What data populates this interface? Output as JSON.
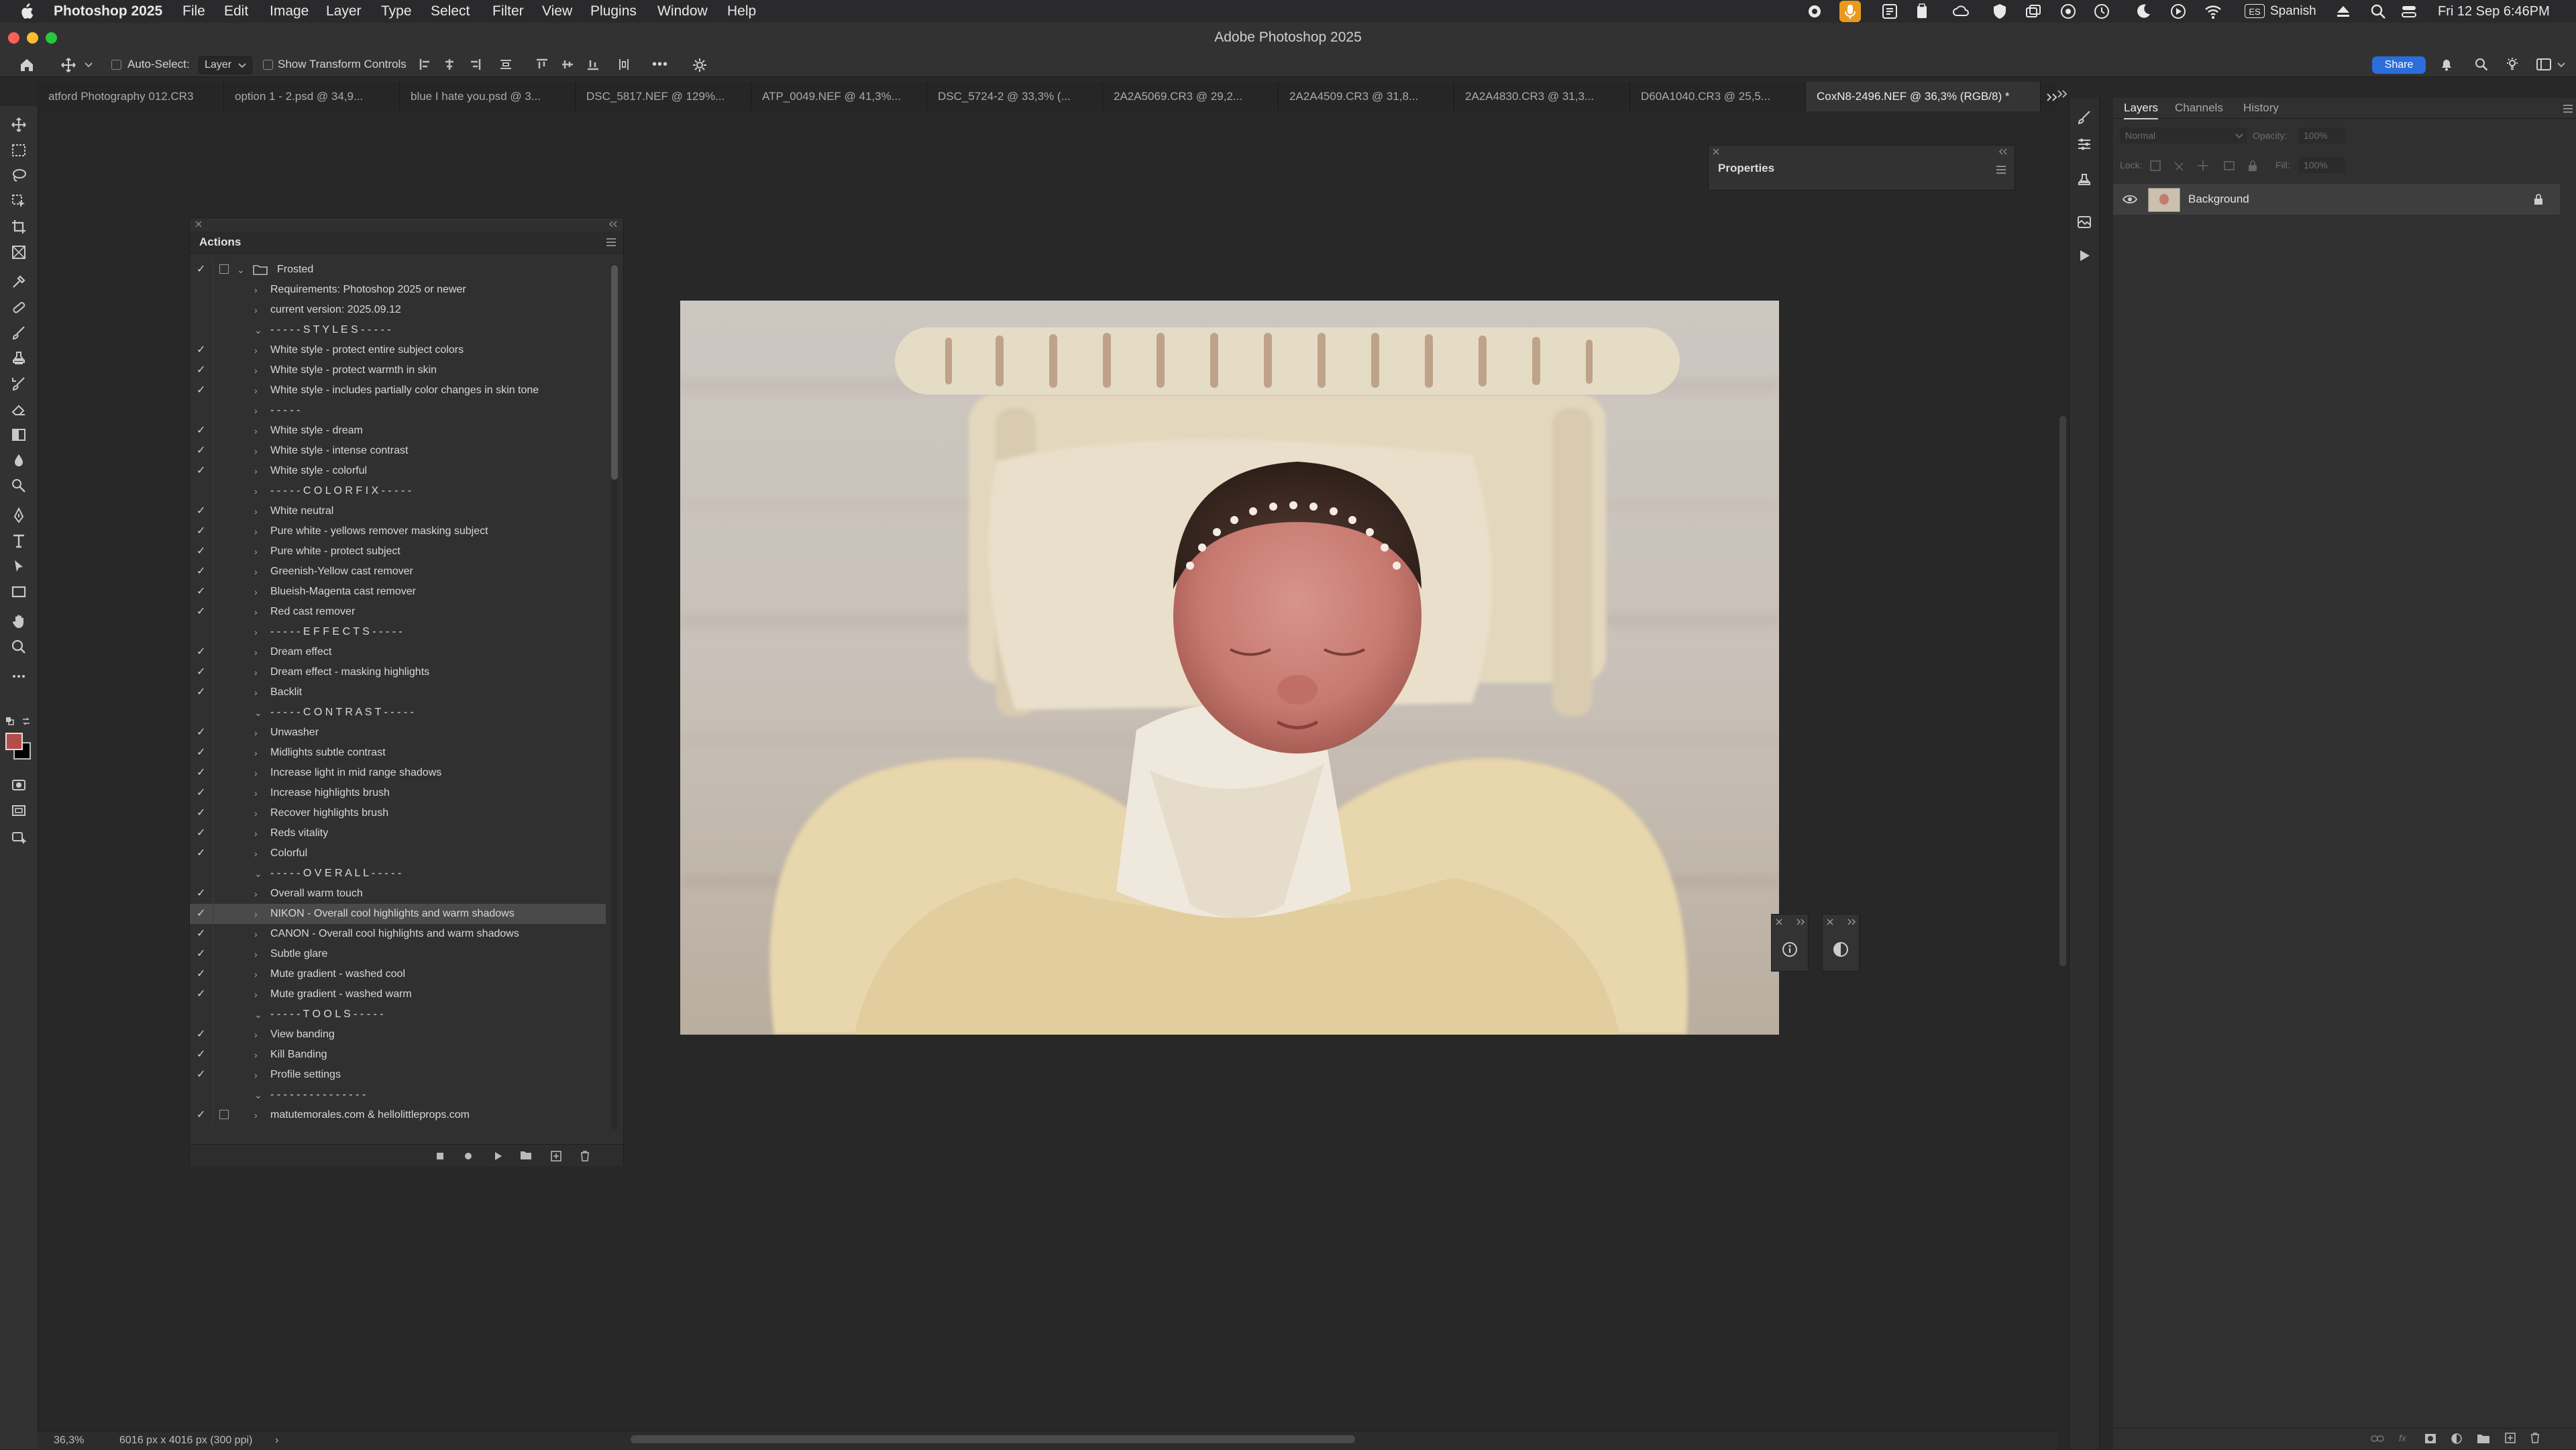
{
  "menubar": {
    "app_name": "Photoshop 2025",
    "menus": [
      "File",
      "Edit",
      "Image",
      "Layer",
      "Type",
      "Select",
      "Filter",
      "View",
      "Plugins",
      "Window",
      "Help"
    ],
    "input_source": "Spanish",
    "datetime": "Fri 12 Sep  6:46PM"
  },
  "window": {
    "title": "Adobe Photoshop 2025"
  },
  "options_bar": {
    "auto_select_label": "Auto-Select:",
    "auto_select_value": "Layer",
    "transform_label": "Show Transform Controls",
    "more_label": "•••",
    "share_label": "Share"
  },
  "tabs": [
    {
      "label": "atford Photography 012.CR3",
      "active": false
    },
    {
      "label": "option 1 - 2.psd @ 34,9...",
      "active": false
    },
    {
      "label": "blue I hate you.psd @ 3...",
      "active": false
    },
    {
      "label": "DSC_5817.NEF @ 129%...",
      "active": false
    },
    {
      "label": "ATP_0049.NEF @ 41,3%...",
      "active": false
    },
    {
      "label": "DSC_5724-2 @ 33,3% (...",
      "active": false
    },
    {
      "label": "2A2A5069.CR3 @ 29,2...",
      "active": false
    },
    {
      "label": "2A2A4509.CR3 @ 31,8...",
      "active": false
    },
    {
      "label": "2A2A4830.CR3 @ 31,3...",
      "active": false
    },
    {
      "label": "D60A1040.CR3 @ 25,5...",
      "active": false
    },
    {
      "label": "CoxN8-2496.NEF @ 36,3% (RGB/8) *",
      "active": true
    }
  ],
  "actions_panel": {
    "title": "Actions",
    "set_name": "Frosted",
    "rows": [
      {
        "label": "Requirements: Photoshop 2025 or newer",
        "checked": false,
        "expanded": false
      },
      {
        "label": "current version: 2025.09.12",
        "checked": false,
        "expanded": false
      },
      {
        "label": "- - - - - S T Y L E S - - - - -",
        "checked": false,
        "expanded": true
      },
      {
        "label": "White style - protect entire subject colors",
        "checked": true,
        "expanded": false
      },
      {
        "label": "White style - protect warmth in skin",
        "checked": true,
        "expanded": false
      },
      {
        "label": "White style - includes partially color changes in skin tone",
        "checked": true,
        "expanded": false
      },
      {
        "label": "- - - - -",
        "checked": false,
        "expanded": false
      },
      {
        "label": "White style - dream",
        "checked": true,
        "expanded": false
      },
      {
        "label": "White style - intense contrast",
        "checked": true,
        "expanded": false
      },
      {
        "label": "White style - colorful",
        "checked": true,
        "expanded": false
      },
      {
        "label": "- - - - - C O L O R  F I X - - - - -",
        "checked": false,
        "expanded": false
      },
      {
        "label": "White neutral",
        "checked": true,
        "expanded": false
      },
      {
        "label": "Pure white - yellows remover masking subject",
        "checked": true,
        "expanded": false
      },
      {
        "label": "Pure white - protect subject",
        "checked": true,
        "expanded": false
      },
      {
        "label": "Greenish-Yellow cast remover",
        "checked": true,
        "expanded": false
      },
      {
        "label": "Blueish-Magenta cast remover",
        "checked": true,
        "expanded": false
      },
      {
        "label": "Red cast remover",
        "checked": true,
        "expanded": false
      },
      {
        "label": "- - - - - E F F E C T S - - - - -",
        "checked": false,
        "expanded": false
      },
      {
        "label": "Dream effect",
        "checked": true,
        "expanded": false
      },
      {
        "label": "Dream effect - masking highlights",
        "checked": true,
        "expanded": false
      },
      {
        "label": "Backlit",
        "checked": true,
        "expanded": false
      },
      {
        "label": "- - - - - C O N T R A S T - - - - -",
        "checked": false,
        "expanded": true
      },
      {
        "label": "Unwasher",
        "checked": true,
        "expanded": false
      },
      {
        "label": "Midlights subtle contrast",
        "checked": true,
        "expanded": false
      },
      {
        "label": "Increase light in mid range shadows",
        "checked": true,
        "expanded": false
      },
      {
        "label": "Increase highlights brush",
        "checked": true,
        "expanded": false
      },
      {
        "label": "Recover highlights brush",
        "checked": true,
        "expanded": false
      },
      {
        "label": "Reds vitality",
        "checked": true,
        "expanded": false
      },
      {
        "label": "Colorful",
        "checked": true,
        "expanded": false
      },
      {
        "label": "- - - - - O V E R A L L - - - - -",
        "checked": false,
        "expanded": true
      },
      {
        "label": "Overall warm touch",
        "checked": true,
        "expanded": false
      },
      {
        "label": "NIKON - Overall cool highlights and warm shadows",
        "checked": true,
        "expanded": false,
        "selected": true
      },
      {
        "label": "CANON - Overall cool highlights and warm shadows",
        "checked": true,
        "expanded": false
      },
      {
        "label": "Subtle glare",
        "checked": true,
        "expanded": false
      },
      {
        "label": "Mute gradient - washed cool",
        "checked": true,
        "expanded": false
      },
      {
        "label": "Mute gradient - washed warm",
        "checked": true,
        "expanded": false
      },
      {
        "label": "- - - - - T O O L S - - - - -",
        "checked": false,
        "expanded": true
      },
      {
        "label": "View banding",
        "checked": true,
        "expanded": false
      },
      {
        "label": "Kill Banding",
        "checked": true,
        "expanded": false
      },
      {
        "label": "Profile settings",
        "checked": true,
        "expanded": false
      },
      {
        "label": "- - - - - - - - - - - - - - -",
        "checked": false,
        "expanded": true
      }
    ],
    "footer_set": "matutemorales.com & hellolittleprops.com"
  },
  "properties_panel": {
    "title": "Properties"
  },
  "layers_panel": {
    "tabs": [
      "Layers",
      "Channels",
      "History"
    ],
    "blend_mode": "Normal",
    "opacity_label": "Opacity:",
    "opacity_value": "100%",
    "lock_label": "Lock:",
    "fill_label": "Fill:",
    "fill_value": "100%",
    "layer_name": "Background"
  },
  "status_bar": {
    "zoom": "36,3%",
    "doc_info": "6016 px x 4016 px (300 ppi)",
    "arrow": "›"
  },
  "colors": {
    "accent": "#2b6ddb",
    "foreground_swatch": "#b64b4b",
    "background_swatch": "#000000"
  }
}
